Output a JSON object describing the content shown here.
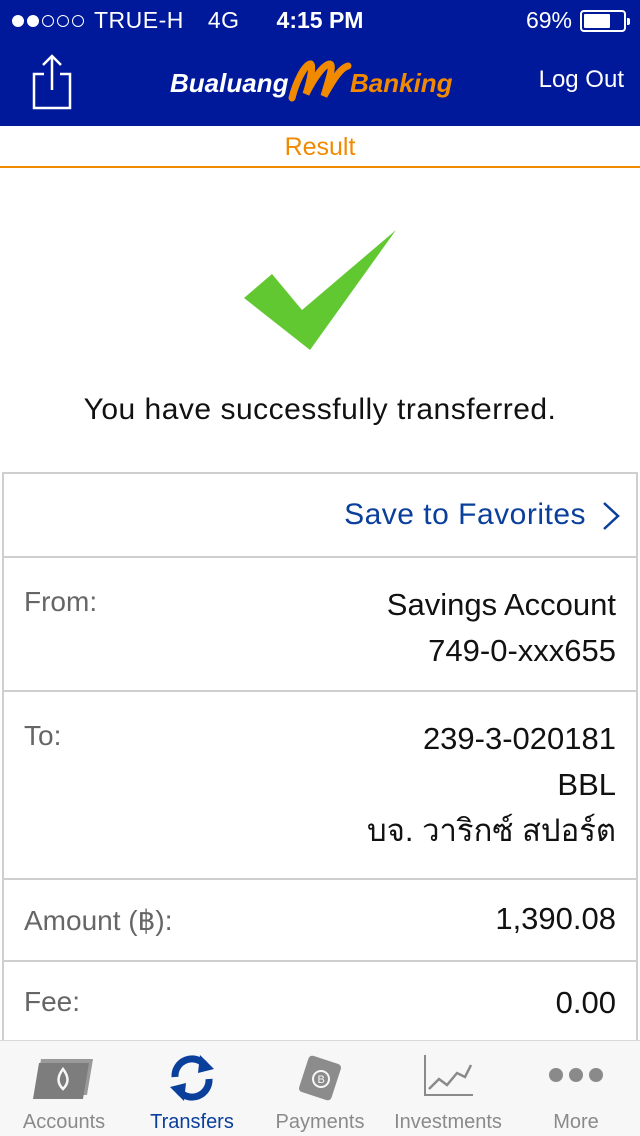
{
  "status_bar": {
    "signal_dots_filled": 2,
    "signal_dots_total": 5,
    "carrier": "TRUE-H",
    "network": "4G",
    "time": "4:15 PM",
    "battery_percent": "69%",
    "battery_level": 0.69
  },
  "header": {
    "share_icon": "share-icon",
    "logo_left": "Bualuang",
    "logo_right": "Banking",
    "logout_label": "Log Out",
    "colors": {
      "background": "#00199b",
      "logo_orange": "#f28a00"
    }
  },
  "page_title": "Result",
  "result": {
    "check_icon": "checkmark-icon",
    "check_color": "#62c832",
    "message": "You have successfully transferred."
  },
  "favorites": {
    "label": "Save to Favorites",
    "icon": "chevron-right-icon"
  },
  "details": {
    "from": {
      "label": "From:",
      "account_type": "Savings Account",
      "account_number": "749-0-xxx655"
    },
    "to": {
      "label": "To:",
      "account_number": "239-3-020181",
      "bank": "BBL",
      "name": "บจ. วาริกซ์ สปอร์ต"
    },
    "amount": {
      "label": "Amount (฿):",
      "value": "1,390.08"
    },
    "fee": {
      "label": "Fee:",
      "value": "0.00"
    }
  },
  "tabbar": {
    "active_color": "#0a3f9c",
    "tabs": [
      {
        "label": "Accounts",
        "icon": "accounts-icon",
        "active": false
      },
      {
        "label": "Transfers",
        "icon": "transfers-icon",
        "active": true
      },
      {
        "label": "Payments",
        "icon": "payments-icon",
        "active": false
      },
      {
        "label": "Investments",
        "icon": "investments-icon",
        "active": false
      },
      {
        "label": "More",
        "icon": "more-icon",
        "active": false
      }
    ]
  }
}
